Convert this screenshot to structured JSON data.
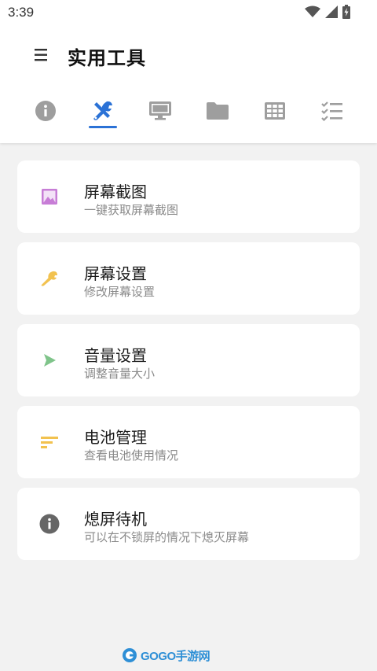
{
  "status_bar": {
    "time": "3:39"
  },
  "toolbar": {
    "title": "实用工具",
    "menu_icon": "hamburger-menu-icon"
  },
  "tabs": [
    {
      "icon": "info-icon",
      "selected": false
    },
    {
      "icon": "tools-icon",
      "selected": true
    },
    {
      "icon": "monitor-icon",
      "selected": false
    },
    {
      "icon": "folder-icon",
      "selected": false
    },
    {
      "icon": "grid-icon",
      "selected": false
    },
    {
      "icon": "checklist-icon",
      "selected": false
    }
  ],
  "cards": [
    {
      "title": "屏幕截图",
      "subtitle": "一键获取屏幕截图",
      "icon": "image-icon",
      "icon_color": "#c77dd6"
    },
    {
      "title": "屏幕设置",
      "subtitle": "修改屏幕设置",
      "icon": "wrench-icon",
      "icon_color": "#f2c24f"
    },
    {
      "title": "音量设置",
      "subtitle": "调整音量大小",
      "icon": "play-icon",
      "icon_color": "#7fc48a"
    },
    {
      "title": "电池管理",
      "subtitle": "查看电池使用情况",
      "icon": "sort-lines-icon",
      "icon_color": "#f2c24f"
    },
    {
      "title": "熄屏待机",
      "subtitle": "可以在不锁屏的情况下熄灭屏幕",
      "icon": "info-icon",
      "icon_color": "#666666"
    }
  ],
  "colors": {
    "accent": "#2b72d6",
    "tab_icon": "#9e9e9e",
    "background": "#f2f2f2"
  },
  "watermark": {
    "text": "GOGO手游网"
  }
}
